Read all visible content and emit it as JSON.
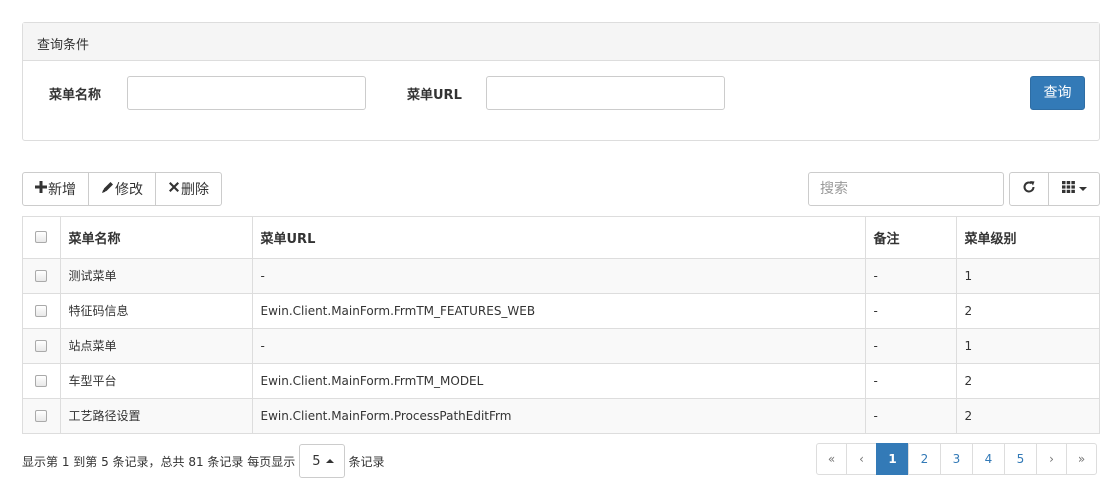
{
  "query_panel": {
    "title": "查询条件",
    "name_label": "菜单名称",
    "name_value": "",
    "url_label": "菜单URL",
    "url_value": "",
    "query_button": "查询"
  },
  "toolbar": {
    "add_label": "新增",
    "edit_label": "修改",
    "delete_label": "删除",
    "add_icon": "plus-icon",
    "edit_icon": "pencil-icon",
    "delete_icon": "times-icon",
    "search_placeholder": "搜索",
    "refresh_icon": "refresh-icon",
    "columns_icon": "grid-icon"
  },
  "table": {
    "columns": [
      "菜单名称",
      "菜单URL",
      "备注",
      "菜单级别"
    ],
    "rows": [
      {
        "name": "测试菜单",
        "url": "-",
        "note": "-",
        "level": "1"
      },
      {
        "name": "特征码信息",
        "url": "Ewin.Client.MainForm.FrmTM_FEATURES_WEB",
        "note": "-",
        "level": "2"
      },
      {
        "name": "站点菜单",
        "url": "-",
        "note": "-",
        "level": "1"
      },
      {
        "name": "车型平台",
        "url": "Ewin.Client.MainForm.FrmTM_MODEL",
        "note": "-",
        "level": "2"
      },
      {
        "name": "工艺路径设置",
        "url": "Ewin.Client.MainForm.ProcessPathEditFrm",
        "note": "-",
        "level": "2"
      }
    ]
  },
  "footer": {
    "info_prefix": "显示第 1 到第 5 条记录，总共 81 条记录 每页显示",
    "page_size": "5",
    "info_suffix": "条记录",
    "pages": {
      "first": "«",
      "prev": "‹",
      "numbers": [
        "1",
        "2",
        "3",
        "4",
        "5"
      ],
      "next": "›",
      "last": "»",
      "active": "1"
    }
  },
  "colors": {
    "primary": "#337ab7",
    "border": "#dddddd",
    "stripe": "#f9f9f9"
  }
}
